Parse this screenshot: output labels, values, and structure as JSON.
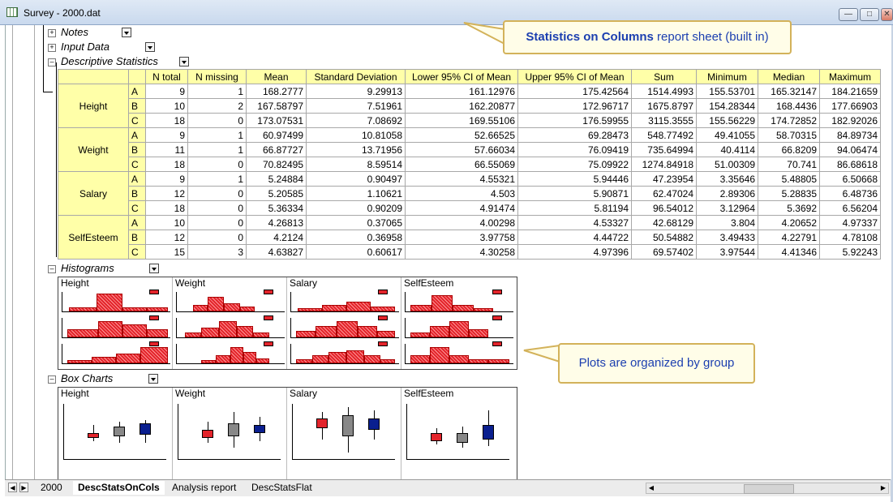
{
  "window": {
    "title": "Survey - 2000.dat"
  },
  "sections": {
    "notes": "Notes",
    "input_data": "Input Data",
    "descriptive": "Descriptive Statistics",
    "histograms": "Histograms",
    "box_charts": "Box Charts"
  },
  "table": {
    "headers": [
      "N total",
      "N missing",
      "Mean",
      "Standard Deviation",
      "Lower 95% CI of Mean",
      "Upper 95% CI of Mean",
      "Sum",
      "Minimum",
      "Median",
      "Maximum"
    ],
    "groups": [
      {
        "name": "Height",
        "rows": [
          {
            "sub": "A",
            "cells": [
              "9",
              "1",
              "168.2777",
              "9.29913",
              "161.12976",
              "175.42564",
              "1514.4993",
              "155.53701",
              "165.32147",
              "184.21659"
            ]
          },
          {
            "sub": "B",
            "cells": [
              "10",
              "2",
              "167.58797",
              "7.51961",
              "162.20877",
              "172.96717",
              "1675.8797",
              "154.28344",
              "168.4436",
              "177.66903"
            ]
          },
          {
            "sub": "C",
            "cells": [
              "18",
              "0",
              "173.07531",
              "7.08692",
              "169.55106",
              "176.59955",
              "3115.3555",
              "155.56229",
              "174.72852",
              "182.92026"
            ]
          }
        ]
      },
      {
        "name": "Weight",
        "rows": [
          {
            "sub": "A",
            "cells": [
              "9",
              "1",
              "60.97499",
              "10.81058",
              "52.66525",
              "69.28473",
              "548.77492",
              "49.41055",
              "58.70315",
              "84.89734"
            ]
          },
          {
            "sub": "B",
            "cells": [
              "11",
              "1",
              "66.87727",
              "13.71956",
              "57.66034",
              "76.09419",
              "735.64994",
              "40.4114",
              "66.8209",
              "94.06474"
            ]
          },
          {
            "sub": "C",
            "cells": [
              "18",
              "0",
              "70.82495",
              "8.59514",
              "66.55069",
              "75.09922",
              "1274.84918",
              "51.00309",
              "70.741",
              "86.68618"
            ]
          }
        ]
      },
      {
        "name": "Salary",
        "rows": [
          {
            "sub": "A",
            "cells": [
              "9",
              "1",
              "5.24884",
              "0.90497",
              "4.55321",
              "5.94446",
              "47.23954",
              "3.35646",
              "5.48805",
              "6.50668"
            ]
          },
          {
            "sub": "B",
            "cells": [
              "12",
              "0",
              "5.20585",
              "1.10621",
              "4.503",
              "5.90871",
              "62.47024",
              "2.89306",
              "5.28835",
              "6.48736"
            ]
          },
          {
            "sub": "C",
            "cells": [
              "18",
              "0",
              "5.36334",
              "0.90209",
              "4.91474",
              "5.81194",
              "96.54012",
              "3.12964",
              "5.3692",
              "6.56204"
            ]
          }
        ]
      },
      {
        "name": "SelfEsteem",
        "rows": [
          {
            "sub": "A",
            "cells": [
              "10",
              "0",
              "4.26813",
              "0.37065",
              "4.00298",
              "4.53327",
              "42.68129",
              "3.804",
              "4.20652",
              "4.97337"
            ]
          },
          {
            "sub": "B",
            "cells": [
              "12",
              "0",
              "4.2124",
              "0.36958",
              "3.97758",
              "4.44722",
              "50.54882",
              "3.49433",
              "4.22791",
              "4.78108"
            ]
          },
          {
            "sub": "C",
            "cells": [
              "15",
              "3",
              "4.63827",
              "0.60617",
              "4.30258",
              "4.97396",
              "69.57402",
              "3.97544",
              "4.41346",
              "5.92243"
            ]
          }
        ]
      }
    ]
  },
  "plot_titles": [
    "Height",
    "Weight",
    "Salary",
    "SelfEsteem"
  ],
  "callouts": {
    "top_bold": "Statistics on Columns",
    "top_rest": " report sheet (built in)",
    "mid": "Plots are organized by group"
  },
  "tabs": [
    "2000",
    "DescStatsOnCols",
    "Analysis report",
    "DescStatsFlat"
  ],
  "active_tab": "DescStatsOnCols",
  "colors": {
    "header_bg": "#ffffa8",
    "hist_red": "#e3242b",
    "callout_text": "#1c3fb0"
  }
}
